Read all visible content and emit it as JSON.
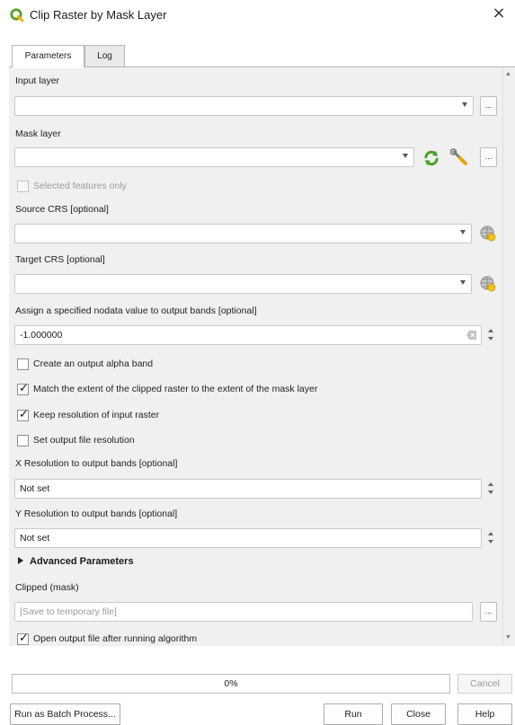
{
  "window": {
    "title": "Clip Raster by Mask Layer",
    "close_glyph": "×",
    "icon": "qgis-logo-icon"
  },
  "tabs": [
    {
      "label": "Parameters",
      "active": true
    },
    {
      "label": "Log",
      "active": false
    }
  ],
  "params": {
    "input_layer": {
      "label": "Input layer",
      "value": "",
      "browse_label": "..."
    },
    "mask_layer": {
      "label": "Mask layer",
      "value": "",
      "browse_label": "..."
    },
    "selected_only": {
      "label": "Selected features only",
      "checked": false,
      "enabled": false
    },
    "source_crs": {
      "label": "Source CRS [optional]",
      "value": ""
    },
    "target_crs": {
      "label": "Target CRS [optional]",
      "value": ""
    },
    "nodata": {
      "label": "Assign a specified nodata value to output bands [optional]",
      "value": "-1.000000"
    },
    "alpha_band": {
      "label": "Create an output alpha band",
      "checked": false
    },
    "match_extent": {
      "label": "Match the extent of the clipped raster to the extent of the mask layer",
      "checked": true
    },
    "keep_resolution": {
      "label": "Keep resolution of input raster",
      "checked": true
    },
    "set_resolution": {
      "label": "Set output file resolution",
      "checked": false
    },
    "x_res": {
      "label": "X Resolution to output bands [optional]",
      "value": "Not set"
    },
    "y_res": {
      "label": "Y Resolution to output bands [optional]",
      "value": "Not set"
    },
    "advanced": {
      "label": "Advanced Parameters",
      "expanded": false
    },
    "clipped": {
      "label": "Clipped (mask)",
      "placeholder": "[Save to temporary file]",
      "browse_label": "..."
    },
    "open_output": {
      "label": "Open output file after running algorithm",
      "checked": true
    }
  },
  "progress": {
    "text": "0%",
    "value": 0
  },
  "buttons": {
    "batch": "Run as Batch Process...",
    "cancel": "Cancel",
    "run": "Run",
    "close": "Close",
    "help": "Help"
  },
  "check_glyph": "✓"
}
